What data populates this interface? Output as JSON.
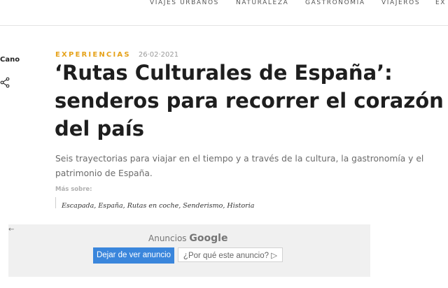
{
  "nav": {
    "items": [
      "VIAJES URBANOS",
      "NATURALEZA",
      "GASTRONOMÍA",
      "VIAJEROS",
      "EX"
    ]
  },
  "author": {
    "name": "Cano"
  },
  "article": {
    "category": "EXPERIENCIAS",
    "date": "26·02·2021",
    "title": "‘Rutas Culturales de España’: senderos para recorrer el corazón del país",
    "subtitle": "Seis trayectorias para viajar en el tiempo y a través de la cultura, la gastronomía y el patrimonio de España.",
    "more_label": "Más sobre:",
    "tags": "Escapada, España, Rutas en coche, Senderismo, Historia"
  },
  "ad": {
    "back_icon": "←",
    "ads_by_label": "Anuncios",
    "ads_by_brand": "Google",
    "stop_label": "Dejar de ver anuncio",
    "why_label": "¿Por qué este anuncio? ▷"
  },
  "colors": {
    "accent": "#e6a21a",
    "ad_button": "#3a86dc"
  }
}
